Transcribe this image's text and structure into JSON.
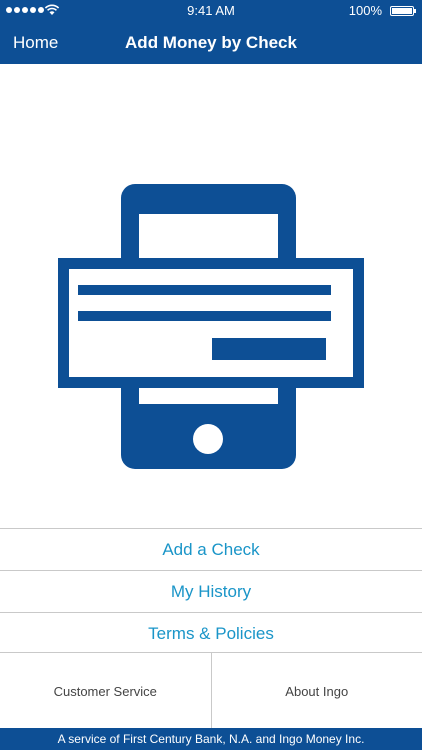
{
  "status_bar": {
    "time": "9:41 AM",
    "battery_percent": "100%",
    "battery_level": 1.0,
    "signal_icon": "signal-dots-icon",
    "wifi_icon": "wifi-icon"
  },
  "nav": {
    "back_label": "Home",
    "title": "Add Money by Check"
  },
  "hero": {
    "icon": "phone-check-icon"
  },
  "menu": {
    "items": [
      {
        "label": "Add a Check"
      },
      {
        "label": "My History"
      },
      {
        "label": "Terms & Policies"
      }
    ]
  },
  "bottom": {
    "customer_service": "Customer Service",
    "about": "About Ingo"
  },
  "footer": {
    "text": "A service of First Century Bank, N.A. and Ingo Money Inc."
  },
  "colors": {
    "brand_blue": "#0d4f95",
    "link_blue": "#1a95c8",
    "divider": "#c9c9c9"
  }
}
